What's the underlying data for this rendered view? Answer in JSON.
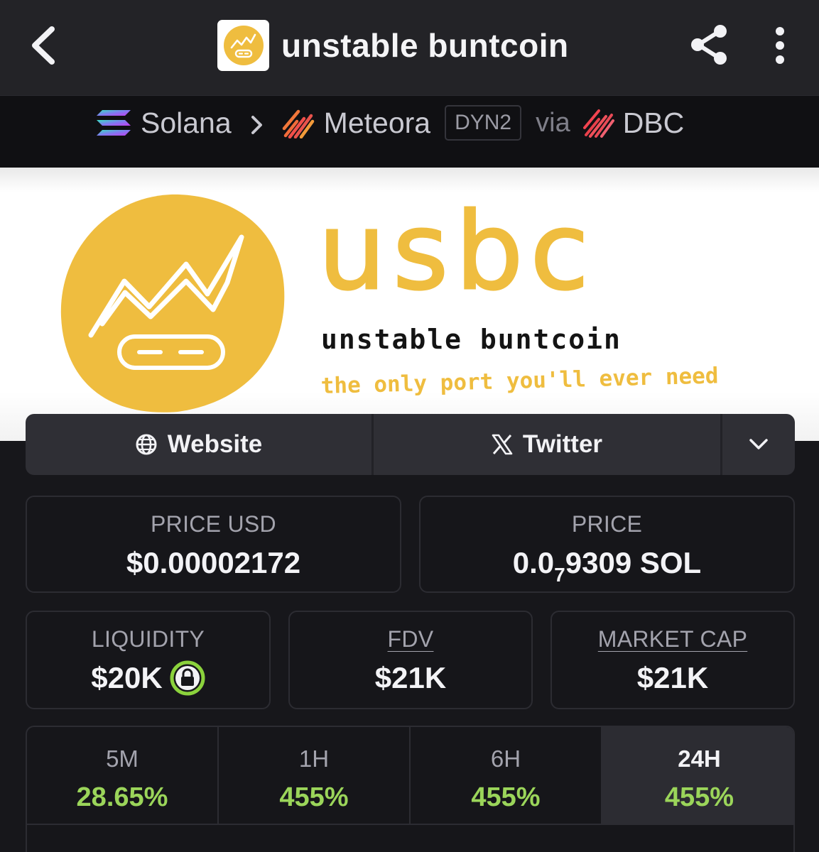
{
  "header": {
    "title": "unstable buntcoin"
  },
  "breadcrumb": {
    "chain": "Solana",
    "dex": "Meteora",
    "pool_type": "DYN2",
    "via": "via",
    "launchpad": "DBC"
  },
  "banner": {
    "ticker": "usbc",
    "name": "unstable buntcoin",
    "tagline": "the only port you'll ever need"
  },
  "links": {
    "website_label": "Website",
    "twitter_label": "Twitter"
  },
  "stats": {
    "price_usd": {
      "label": "PRICE USD",
      "value": "$0.00002172"
    },
    "price": {
      "label": "PRICE",
      "prefix": "0.0",
      "zeros": "7",
      "suffix": "9309 SOL"
    },
    "liquidity": {
      "label": "LIQUIDITY",
      "value": "$20K"
    },
    "fdv": {
      "label": "FDV",
      "value": "$21K"
    },
    "market_cap": {
      "label": "MARKET CAP",
      "value": "$21K"
    }
  },
  "periods": [
    {
      "label": "5M",
      "value": "28.65%",
      "active": false
    },
    {
      "label": "1H",
      "value": "455%",
      "active": false
    },
    {
      "label": "6H",
      "value": "455%",
      "active": false
    },
    {
      "label": "24H",
      "value": "455%",
      "active": true
    }
  ],
  "colors": {
    "accent_yellow": "#efbd3f",
    "positive_green": "#9bd55a",
    "lock_green": "#8bd23c"
  },
  "icons": [
    "back-arrow-icon",
    "share-icon",
    "more-vertical-icon",
    "solana-icon",
    "chevron-right-icon",
    "meteora-icon",
    "dbc-icon",
    "globe-icon",
    "x-icon",
    "chevron-down-icon",
    "lock-icon"
  ]
}
